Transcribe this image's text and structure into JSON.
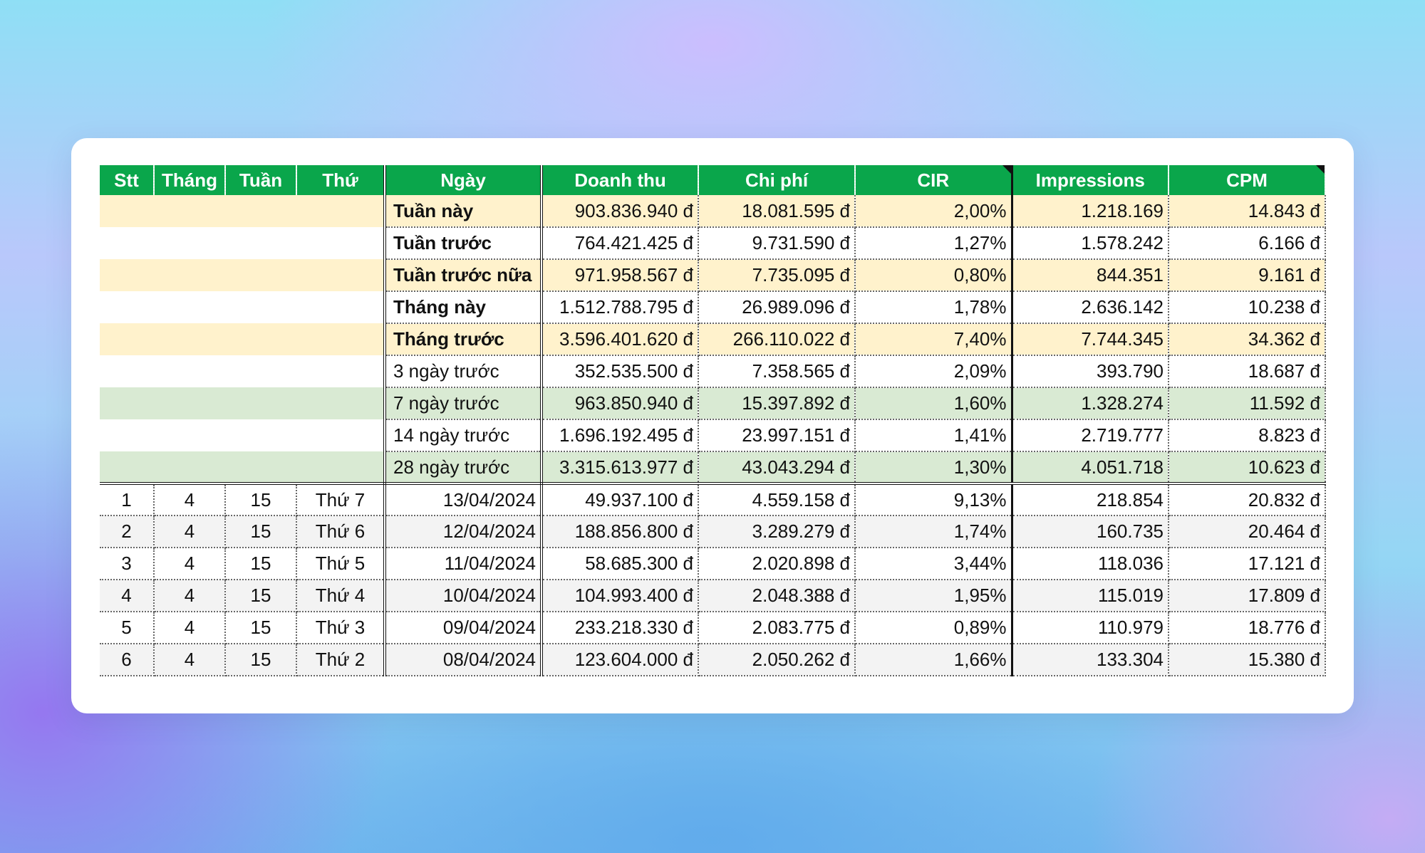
{
  "columns": [
    "Stt",
    "Tháng",
    "Tuần",
    "Thứ",
    "Ngày",
    "Doanh thu",
    "Chi phí",
    "CIR",
    "Impressions",
    "CPM"
  ],
  "summary_rows": [
    {
      "label": "Tuần này",
      "doanh_thu": "903.836.940 đ",
      "chi_phi": "18.081.595 đ",
      "cir": "2,00%",
      "impressions": "1.218.169",
      "cpm": "14.843 đ",
      "bold": true,
      "bg": "yellow"
    },
    {
      "label": "Tuần trước",
      "doanh_thu": "764.421.425 đ",
      "chi_phi": "9.731.590 đ",
      "cir": "1,27%",
      "impressions": "1.578.242",
      "cpm": "6.166 đ",
      "bold": true,
      "bg": "white"
    },
    {
      "label": "Tuần trước nữa",
      "doanh_thu": "971.958.567 đ",
      "chi_phi": "7.735.095 đ",
      "cir": "0,80%",
      "impressions": "844.351",
      "cpm": "9.161 đ",
      "bold": true,
      "bg": "yellow"
    },
    {
      "label": "Tháng này",
      "doanh_thu": "1.512.788.795 đ",
      "chi_phi": "26.989.096 đ",
      "cir": "1,78%",
      "impressions": "2.636.142",
      "cpm": "10.238 đ",
      "bold": true,
      "bg": "white"
    },
    {
      "label": "Tháng trước",
      "doanh_thu": "3.596.401.620 đ",
      "chi_phi": "266.110.022 đ",
      "cir": "7,40%",
      "impressions": "7.744.345",
      "cpm": "34.362 đ",
      "bold": true,
      "bg": "yellow"
    },
    {
      "label": "3 ngày trước",
      "doanh_thu": "352.535.500 đ",
      "chi_phi": "7.358.565 đ",
      "cir": "2,09%",
      "impressions": "393.790",
      "cpm": "18.687 đ",
      "bold": false,
      "bg": "white"
    },
    {
      "label": "7 ngày trước",
      "doanh_thu": "963.850.940 đ",
      "chi_phi": "15.397.892 đ",
      "cir": "1,60%",
      "impressions": "1.328.274",
      "cpm": "11.592 đ",
      "bold": false,
      "bg": "green"
    },
    {
      "label": "14 ngày trước",
      "doanh_thu": "1.696.192.495 đ",
      "chi_phi": "23.997.151 đ",
      "cir": "1,41%",
      "impressions": "2.719.777",
      "cpm": "8.823 đ",
      "bold": false,
      "bg": "white"
    },
    {
      "label": "28 ngày trước",
      "doanh_thu": "3.315.613.977 đ",
      "chi_phi": "43.043.294 đ",
      "cir": "1,30%",
      "impressions": "4.051.718",
      "cpm": "10.623 đ",
      "bold": false,
      "bg": "green"
    }
  ],
  "daily_rows": [
    {
      "stt": "1",
      "thang": "4",
      "tuan": "15",
      "thu": "Thứ 7",
      "ngay": "13/04/2024",
      "doanh_thu": "49.937.100 đ",
      "chi_phi": "4.559.158 đ",
      "cir": "9,13%",
      "impressions": "218.854",
      "cpm": "20.832 đ"
    },
    {
      "stt": "2",
      "thang": "4",
      "tuan": "15",
      "thu": "Thứ 6",
      "ngay": "12/04/2024",
      "doanh_thu": "188.856.800 đ",
      "chi_phi": "3.289.279 đ",
      "cir": "1,74%",
      "impressions": "160.735",
      "cpm": "20.464 đ"
    },
    {
      "stt": "3",
      "thang": "4",
      "tuan": "15",
      "thu": "Thứ 5",
      "ngay": "11/04/2024",
      "doanh_thu": "58.685.300 đ",
      "chi_phi": "2.020.898 đ",
      "cir": "3,44%",
      "impressions": "118.036",
      "cpm": "17.121 đ"
    },
    {
      "stt": "4",
      "thang": "4",
      "tuan": "15",
      "thu": "Thứ 4",
      "ngay": "10/04/2024",
      "doanh_thu": "104.993.400 đ",
      "chi_phi": "2.048.388 đ",
      "cir": "1,95%",
      "impressions": "115.019",
      "cpm": "17.809 đ"
    },
    {
      "stt": "5",
      "thang": "4",
      "tuan": "15",
      "thu": "Thứ 3",
      "ngay": "09/04/2024",
      "doanh_thu": "233.218.330 đ",
      "chi_phi": "2.083.775 đ",
      "cir": "0,89%",
      "impressions": "110.979",
      "cpm": "18.776 đ"
    },
    {
      "stt": "6",
      "thang": "4",
      "tuan": "15",
      "thu": "Thứ 2",
      "ngay": "08/04/2024",
      "doanh_thu": "123.604.000 đ",
      "chi_phi": "2.050.262 đ",
      "cir": "1,66%",
      "impressions": "133.304",
      "cpm": "15.380 đ"
    }
  ],
  "colors": {
    "header": "#0aa64b",
    "yellow": "#fff2cc",
    "green": "#d9ead3",
    "gray": "#f3f3f3"
  }
}
